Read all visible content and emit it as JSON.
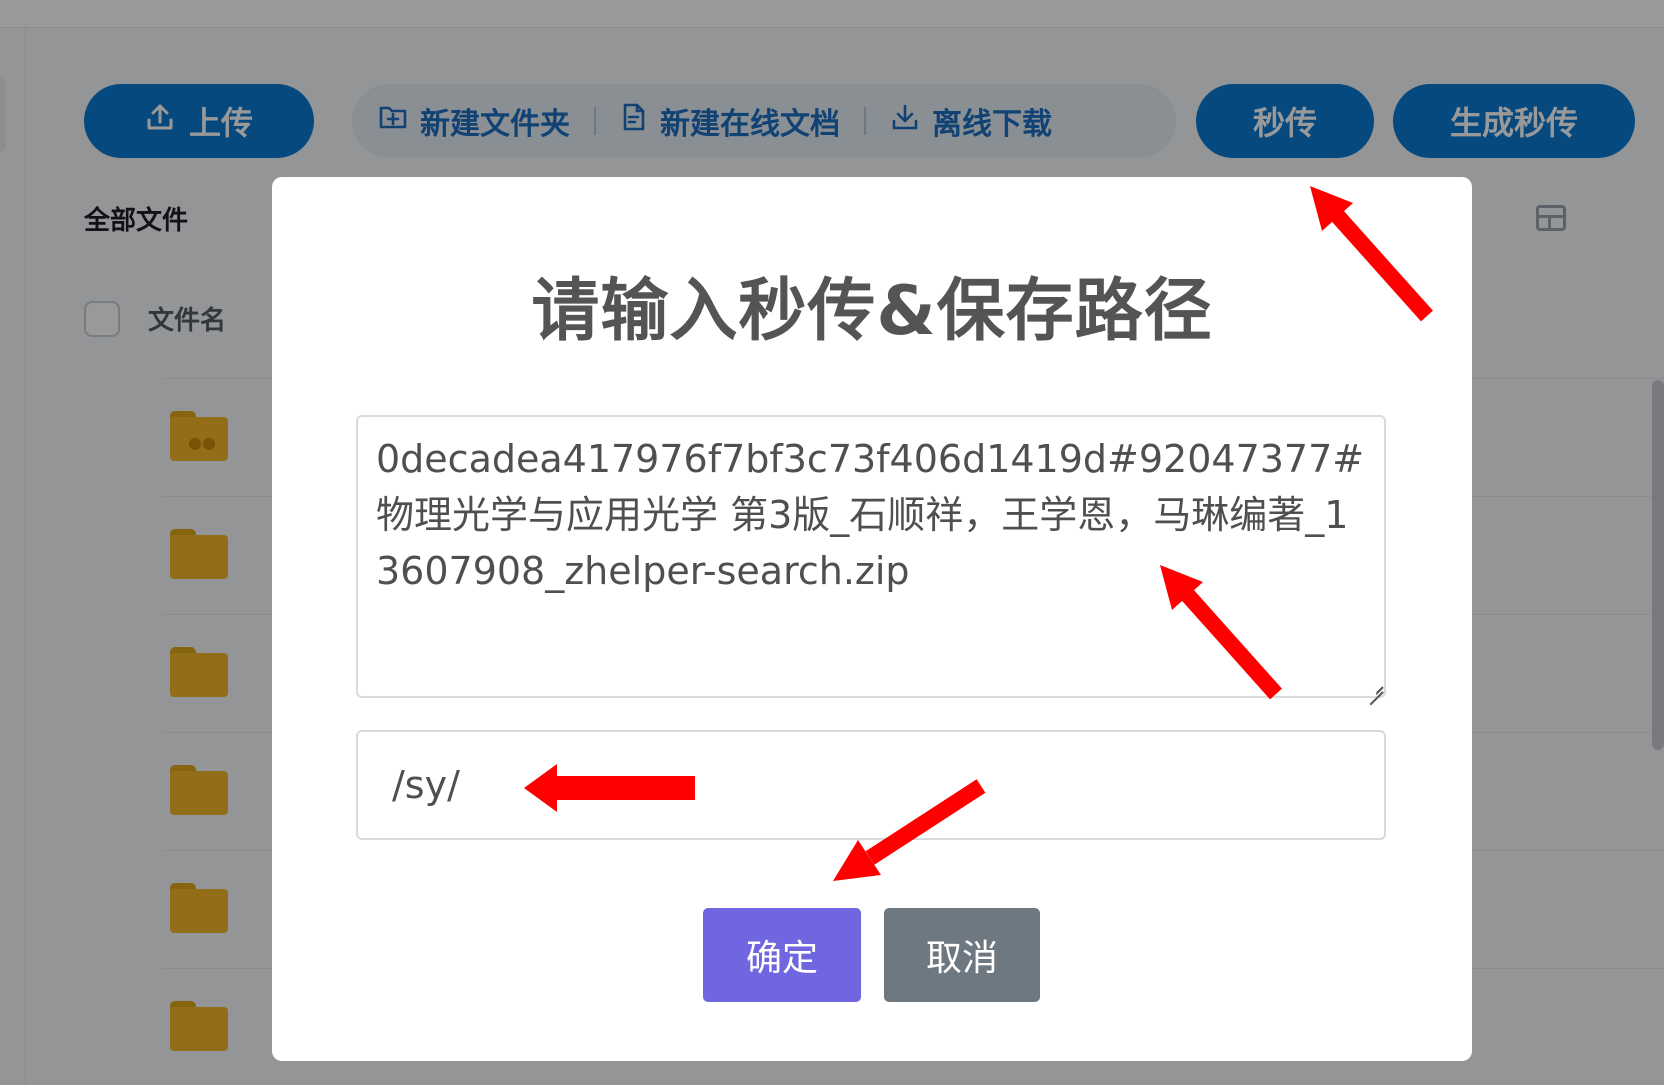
{
  "toolbar": {
    "upload_label": "上传",
    "new_folder_label": "新建文件夹",
    "new_doc_label": "新建在线文档",
    "offline_download_label": "离线下载",
    "instant_upload_label": "秒传",
    "generate_instant_label": "生成秒传"
  },
  "file_list": {
    "breadcrumb": "全部文件",
    "column_name": "文件名",
    "rows": [
      {
        "icon": "shared-folder-icon"
      },
      {
        "icon": "folder-icon"
      },
      {
        "icon": "folder-icon"
      },
      {
        "icon": "folder-icon"
      },
      {
        "icon": "folder-icon"
      },
      {
        "icon": "folder-icon"
      }
    ]
  },
  "modal": {
    "title": "请输入秒传&保存路径",
    "hash_value": "0decadea417976f7bf3c73f406d1419d#92047377#物理光学与应用光学 第3版_石顺祥，王学恩，马琳编著_13607908_zhelper-search.zip",
    "path_value": "/sy/",
    "confirm_label": "确定",
    "cancel_label": "取消"
  },
  "colors": {
    "primary_blue": "#0a7bd2",
    "confirm_purple": "#7066e0",
    "cancel_gray": "#6e7881",
    "arrow_red": "#ff0000",
    "folder_yellow": "#f5b82a"
  }
}
